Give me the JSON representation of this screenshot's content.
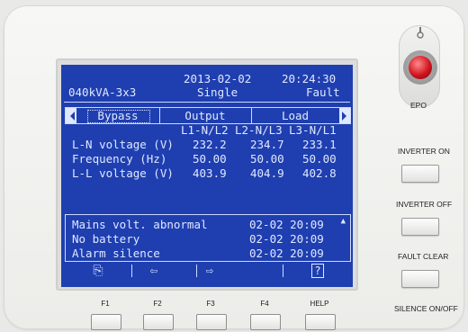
{
  "lcd": {
    "header": {
      "model": "040kVA-3x3",
      "date": "2013-02-02",
      "time": "20:24:30",
      "mode": "Single",
      "status": "Fault"
    },
    "tabs": [
      "Bypass",
      "Output",
      "Load"
    ],
    "selected_tab": "Bypass",
    "table": {
      "columns": [
        "L1-N/L2",
        "L2-N/L3",
        "L3-N/L1"
      ],
      "rows": [
        {
          "label": "L-N voltage (V)",
          "values": [
            "232.2",
            "234.7",
            "233.1"
          ]
        },
        {
          "label": "Frequency (Hz)",
          "values": [
            "50.00",
            "50.00",
            "50.00"
          ]
        },
        {
          "label": "L-L voltage (V)",
          "values": [
            "403.9",
            "404.9",
            "402.8"
          ]
        }
      ]
    },
    "alarms": [
      {
        "text": "Mains volt. abnormal",
        "time": "02-02 20:09"
      },
      {
        "text": "No battery",
        "time": "02-02 20:09"
      },
      {
        "text": "Alarm silence",
        "time": "02-02 20:09"
      }
    ],
    "softkeys": [
      "home-icon",
      "left-arrow-icon",
      "right-arrow-icon",
      "help-icon"
    ],
    "lcd_color": "#1f3fb0"
  },
  "side_buttons": {
    "epo": "EPO",
    "inverter_on": "INVERTER ON",
    "inverter_off": "INVERTER OFF",
    "fault_clear": "FAULT CLEAR",
    "silence": "SILENCE ON/OFF"
  },
  "function_keys": [
    "F1",
    "F2",
    "F3",
    "F4",
    "HELP"
  ]
}
